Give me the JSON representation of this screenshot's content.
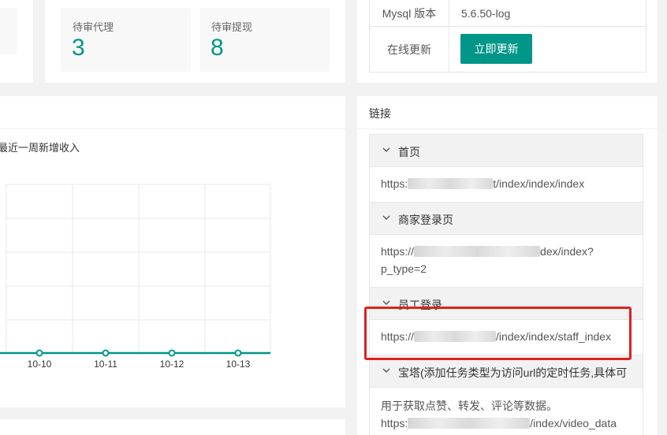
{
  "stats": [
    {
      "label": "待审代理",
      "value": "3"
    },
    {
      "label": "待审提现",
      "value": "8"
    }
  ],
  "system_info": [
    {
      "key": "Mysql 版本",
      "value": "5.6.50-log"
    },
    {
      "key": "在线更新",
      "button": "立即更新"
    }
  ],
  "chart_panel": {
    "caption": "最近一周新增收入"
  },
  "chart_data": {
    "type": "line",
    "categories": [
      "10-10",
      "10-11",
      "10-12",
      "10-13"
    ],
    "values": [
      0,
      0,
      0,
      0
    ],
    "title": "",
    "xlabel": "",
    "ylabel": "",
    "grid": true,
    "color": "#009688"
  },
  "links_panel": {
    "title": "链接",
    "items": [
      {
        "label": "首页",
        "body_prefix": "https:",
        "body_suffix": "t/index/index/index"
      },
      {
        "label": "商家登录页",
        "body_prefix": "https://",
        "body_suffix": "dex/index?",
        "body_line2": "p_type=2"
      },
      {
        "label": "员工登录",
        "body_prefix": "https://",
        "body_suffix": "/index/index/staff_index"
      },
      {
        "label": "宝塔(添加任务类型为访问url的定时任务,具体可",
        "body_line1": "用于获取点赞、转发、评论等数据。",
        "body_prefix": "https:",
        "body_suffix": "/index/video_data"
      }
    ]
  },
  "colors": {
    "accent": "#009688",
    "highlight": "#e02020"
  }
}
